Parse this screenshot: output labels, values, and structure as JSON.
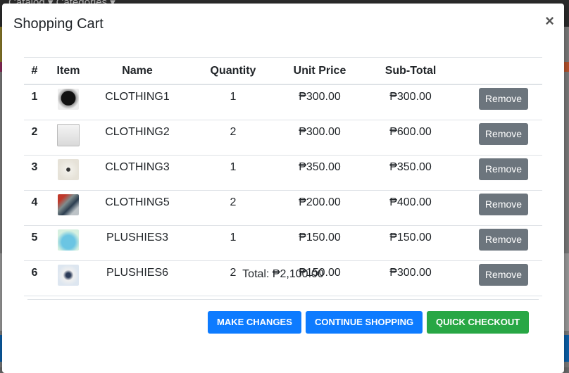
{
  "background": {
    "topbar_text": "Catalog ▾  Categories ▾"
  },
  "modal": {
    "title": "Shopping Cart",
    "close_label": "×"
  },
  "table": {
    "headers": [
      "#",
      "Item",
      "Name",
      "Quantity",
      "Unit Price",
      "Sub-Total",
      ""
    ],
    "rows": [
      {
        "num": "1",
        "icon": "black-jacket-thumbnail",
        "name": "CLOTHING1",
        "qty": "1",
        "unit": "₱300.00",
        "sub": "₱300.00",
        "action": "Remove"
      },
      {
        "num": "2",
        "icon": "white-shirt-thumbnail",
        "name": "CLOTHING2",
        "qty": "2",
        "unit": "₱300.00",
        "sub": "₱600.00",
        "action": "Remove"
      },
      {
        "num": "3",
        "icon": "white-sweater-thumbnail",
        "name": "CLOTHING3",
        "qty": "1",
        "unit": "₱350.00",
        "sub": "₱350.00",
        "action": "Remove"
      },
      {
        "num": "4",
        "icon": "clothing-set-thumbnail",
        "name": "CLOTHING5",
        "qty": "2",
        "unit": "₱200.00",
        "sub": "₱400.00",
        "action": "Remove"
      },
      {
        "num": "5",
        "icon": "blue-plush-thumbnail",
        "name": "PLUSHIES3",
        "qty": "1",
        "unit": "₱150.00",
        "sub": "₱150.00",
        "action": "Remove"
      },
      {
        "num": "6",
        "icon": "plush-figure-thumbnail",
        "name": "PLUSHIES6",
        "qty": "2",
        "unit": "₱150.00",
        "sub": "₱300.00",
        "action": "Remove"
      }
    ]
  },
  "total": "Total: ₱2,100.00",
  "buttons": {
    "make_changes": "MAKE CHANGES",
    "continue_shopping": "CONTINUE SHOPPING",
    "quick_checkout": "QUICK CHECKOUT"
  },
  "colors": {
    "primary": "#0d7bff",
    "success": "#28a745",
    "secondary": "#6c757d"
  }
}
